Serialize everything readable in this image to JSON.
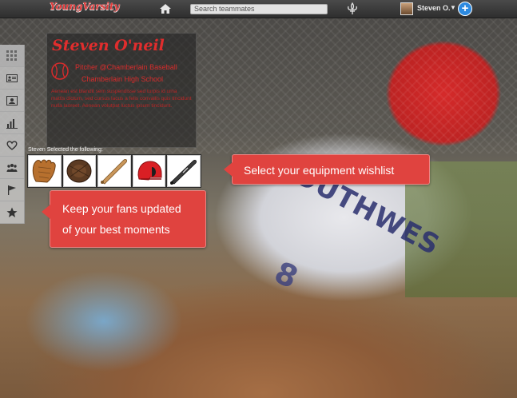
{
  "app": {
    "logo_text": "YoungVarsity"
  },
  "header": {
    "search_placeholder": "Search teammates",
    "user_name": "Steven O.",
    "caret": "▼",
    "add_label": "+"
  },
  "profile": {
    "name": "Steven O'neil",
    "position_line": "Pitcher @Chamberlain Baseball",
    "school_line": "Chamberlain High School",
    "bio": "Aenean est blandit sem suspendisse sed turpis id urna mattis dictum, sed cursus lacus a felis convallis quis tincidunt nulla laoreet. Aenean volutpat luctus ipsum tincidunt."
  },
  "wishlist": {
    "label": "Steven Selected the following:",
    "items": [
      "baseball-glove",
      "catchers-mitt",
      "wood-bat",
      "batting-helmet",
      "aluminum-bat"
    ]
  },
  "callouts": {
    "equipment": "Select your equipment wishlist",
    "fans_line1": "Keep your fans updated",
    "fans_line2": "of your best moments"
  },
  "photo_text": {
    "jersey": "SOUTHWES",
    "number": "8"
  },
  "sidebar": {
    "icons": [
      "grid-icon",
      "id-card-icon",
      "profile-card-icon",
      "bar-chart-icon",
      "heart-icon",
      "team-icon",
      "flag-icon",
      "star-icon"
    ]
  },
  "colors": {
    "accent": "#e0433f",
    "brand_red": "#e12d2d",
    "plus_blue": "#2d8ae0"
  }
}
